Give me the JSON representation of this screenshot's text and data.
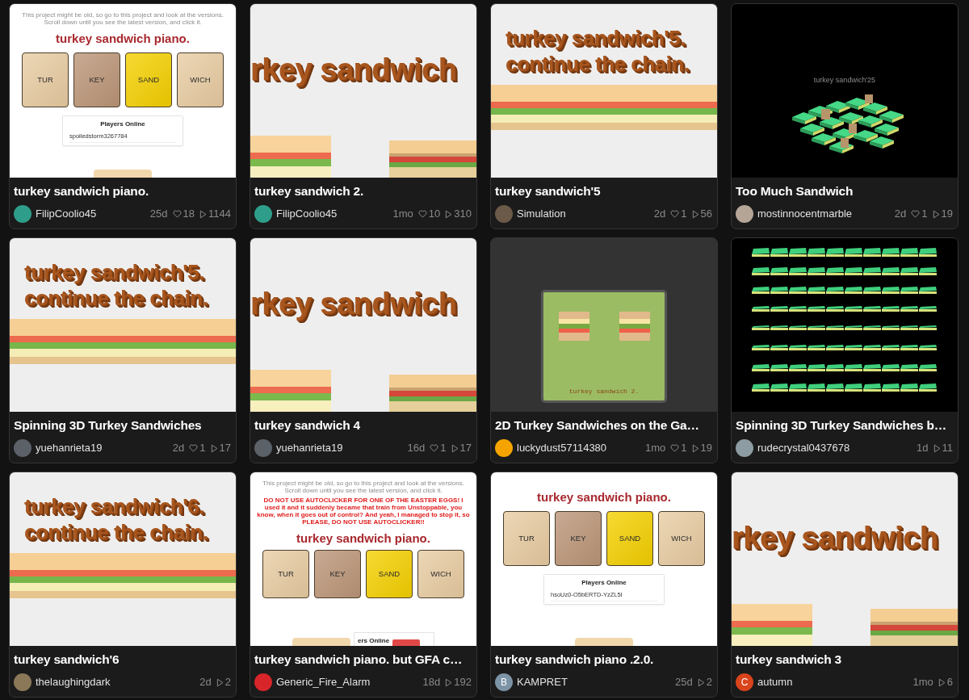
{
  "cards": [
    {
      "title": "turkey sandwich piano.",
      "author": "FilipCoolio45",
      "avatar": {
        "color": "#2e9e8a"
      },
      "age": "25d",
      "likes": "18",
      "views": "1144",
      "thumbnail": {
        "kind": "piano",
        "notice": "This project might be old, so go to this project and look at the versions. Scroll down until you see the latest version, and click it.",
        "heading": "turkey sandwich piano.",
        "keys": [
          {
            "label": "TUR",
            "color": "#e8cca2"
          },
          {
            "label": "KEY",
            "color": "#bb9577"
          },
          {
            "label": "SAND",
            "color": "#f4d000"
          },
          {
            "label": "WICH",
            "color": "#e8cca2"
          }
        ],
        "panel": {
          "title": "Players Online",
          "players": [
            "spoiledstorm3267784"
          ]
        }
      }
    },
    {
      "title": "turkey sandwich 2.",
      "author": "FilipCoolio45",
      "avatar": {
        "color": "#2e9e8a"
      },
      "age": "1mo",
      "likes": "10",
      "views": "310",
      "thumbnail": {
        "kind": "banner",
        "lines": [
          "rkey sandwich"
        ]
      }
    },
    {
      "title": "turkey sandwich'5",
      "author": "Simulation",
      "avatar": {
        "color": "#6b5a48"
      },
      "age": "2d",
      "likes": "1",
      "views": "56",
      "thumbnail": {
        "kind": "chain",
        "lines": [
          "turkey sandwich'5.",
          "continue the chain."
        ]
      }
    },
    {
      "title": "Too Much Sandwich",
      "author": "mostinnocentmarble",
      "avatar": {
        "color": "#b5a597"
      },
      "age": "2d",
      "likes": "1",
      "views": "19",
      "thumbnail": {
        "kind": "pile",
        "label": "turkey sandwich'25"
      }
    },
    {
      "title": "Spinning 3D Turkey Sandwiches",
      "author": "yuehanrieta19",
      "avatar": {
        "color": "#5b6168"
      },
      "age": "2d",
      "likes": "1",
      "views": "17",
      "thumbnail": {
        "kind": "chain",
        "lines": [
          "turkey sandwich'5.",
          "continue the chain."
        ]
      }
    },
    {
      "title": "turkey sandwich 4",
      "author": "yuehanrieta19",
      "avatar": {
        "color": "#5b6168"
      },
      "age": "16d",
      "likes": "1",
      "views": "17",
      "thumbnail": {
        "kind": "banner",
        "lines": [
          "rkey sandwich"
        ]
      }
    },
    {
      "title": "2D Turkey Sandwiches on the Ga…",
      "author": "luckydust57114380",
      "avatar": {
        "color": "#f5a300"
      },
      "age": "1mo",
      "likes": "1",
      "views": "19",
      "thumbnail": {
        "kind": "pixel",
        "caption": "turkey sandwich 2."
      }
    },
    {
      "title": "Spinning 3D Turkey Sandwiches b…",
      "author": "rudecrystal0437678",
      "avatar": {
        "color": "#8c9ca2"
      },
      "age": "1d",
      "views": "11",
      "thumbnail": {
        "kind": "grid"
      }
    },
    {
      "title": "turkey sandwich'6",
      "author": "thelaughingdark",
      "avatar": {
        "color": "#8a7858"
      },
      "age": "2d",
      "views": "2",
      "thumbnail": {
        "kind": "chain",
        "lines": [
          "turkey sandwich'6.",
          "continue the chain."
        ]
      }
    },
    {
      "title": "turkey sandwich piano. but GFA c…",
      "author": "Generic_Fire_Alarm",
      "avatar": {
        "color": "#d8252a"
      },
      "age": "18d",
      "views": "192",
      "thumbnail": {
        "kind": "piano",
        "notice": "This project might be old, so go to this project and look at the versions. Scroll down until you see the latest version, and click it.",
        "warning": "DO NOT USE AUTOCLICKER FOR ONE OF THE EASTER EGGS! I used it and it suddenly became that train from Unstoppable, you know, when it goes out of control? And yeah, I managed to stop it, so PLEASE, DO NOT USE AUTOCLICKER!!",
        "heading": "turkey sandwich piano.",
        "keys": [
          {
            "label": "TUR",
            "color": "#e8cca2"
          },
          {
            "label": "KEY",
            "color": "#bb9577"
          },
          {
            "label": "SAND",
            "color": "#f4d000"
          },
          {
            "label": "WICH",
            "color": "#e8cca2"
          }
        ],
        "corner_panel": {
          "title": "ers Online"
        }
      }
    },
    {
      "title": "turkey sandwich piano .2.0.",
      "author": "KAMPRET",
      "avatar": {
        "color": "#7d93a6",
        "letter": "B"
      },
      "age": "25d",
      "views": "2",
      "thumbnail": {
        "kind": "piano",
        "heading": "turkey sandwich piano.",
        "keys": [
          {
            "label": "TUR",
            "color": "#e8cca2"
          },
          {
            "label": "KEY",
            "color": "#bb9577"
          },
          {
            "label": "SAND",
            "color": "#f4d000"
          },
          {
            "label": "WICH",
            "color": "#e8cca2"
          }
        ],
        "panel": {
          "title": "Players Online",
          "players": [
            "hsoUz0-O5bERTD-YzZL5I"
          ]
        }
      }
    },
    {
      "title": "turkey sandwich 3",
      "author": "autumn",
      "avatar": {
        "color": "#d9441c",
        "letter": "C"
      },
      "age": "1mo",
      "views": "6",
      "thumbnail": {
        "kind": "banner",
        "lines": [
          "rkey sandwich"
        ]
      }
    }
  ]
}
